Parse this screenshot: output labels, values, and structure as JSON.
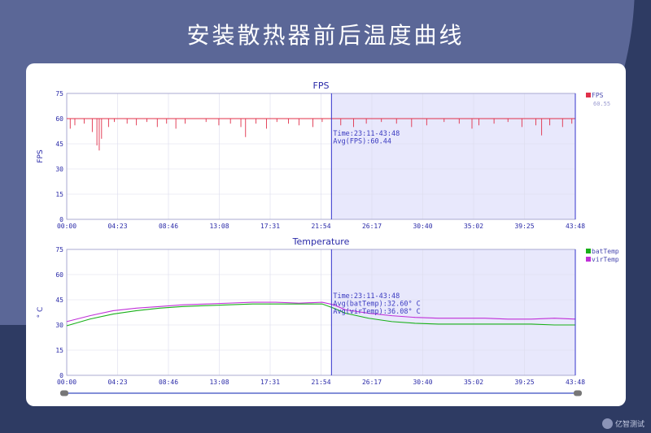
{
  "headline": "安装散热器前后温度曲线",
  "watermark": "亿智测试",
  "colors": {
    "fps": "#e0304a",
    "batTemp": "#18b018",
    "virTemp": "#c030d8",
    "highlight": "#e8e8fc",
    "cursor": "#3333cc",
    "axis_text": "#2a2aa8"
  },
  "chart_data": [
    {
      "type": "line",
      "title": "FPS",
      "ylabel": "FPS",
      "xlabel": "",
      "ylim": [
        0,
        75
      ],
      "yticks": [
        "0",
        "15",
        "30",
        "45",
        "60",
        "75"
      ],
      "xticks": [
        "00:00",
        "04:23",
        "08:46",
        "13:08",
        "17:31",
        "21:54",
        "26:17",
        "30:40",
        "35:02",
        "39:25",
        "43:48"
      ],
      "grid": true,
      "legend": "top-right",
      "highlight_range": [
        22.8,
        43.8
      ],
      "cursor_at": 22.8,
      "annotation": [
        "Time:23:11-43:48",
        "Avg(FPS):60.44"
      ],
      "series": [
        {
          "name": "FPS",
          "legend_sub": "60.55",
          "baseline": 60,
          "dips": [
            [
              0.3,
              54
            ],
            [
              0.7,
              56
            ],
            [
              1.5,
              57
            ],
            [
              2.2,
              52
            ],
            [
              2.6,
              44
            ],
            [
              2.8,
              41
            ],
            [
              3.0,
              48
            ],
            [
              3.6,
              55
            ],
            [
              4.1,
              58
            ],
            [
              5.2,
              57
            ],
            [
              6.0,
              56
            ],
            [
              6.9,
              58
            ],
            [
              7.8,
              55
            ],
            [
              8.6,
              57
            ],
            [
              9.4,
              54
            ],
            [
              10.2,
              57
            ],
            [
              12.0,
              58
            ],
            [
              13.1,
              56
            ],
            [
              14.1,
              57
            ],
            [
              15.0,
              55
            ],
            [
              15.4,
              49
            ],
            [
              16.3,
              57
            ],
            [
              17.2,
              54
            ],
            [
              18.1,
              58
            ],
            [
              19.1,
              57
            ],
            [
              20.0,
              56
            ],
            [
              21.2,
              55
            ],
            [
              22.0,
              58
            ],
            [
              23.6,
              56
            ],
            [
              24.7,
              55
            ],
            [
              25.8,
              57
            ],
            [
              27.1,
              58
            ],
            [
              28.4,
              57
            ],
            [
              29.7,
              55
            ],
            [
              31.0,
              56
            ],
            [
              32.5,
              58
            ],
            [
              33.8,
              57
            ],
            [
              34.9,
              54
            ],
            [
              35.5,
              56
            ],
            [
              36.8,
              57
            ],
            [
              38.0,
              58
            ],
            [
              39.2,
              55
            ],
            [
              40.4,
              56
            ],
            [
              40.9,
              50
            ],
            [
              41.6,
              56
            ],
            [
              42.7,
              55
            ],
            [
              43.5,
              57
            ]
          ]
        }
      ]
    },
    {
      "type": "line",
      "title": "Temperature",
      "ylabel": "° C",
      "xlabel": "",
      "ylim": [
        0,
        75
      ],
      "yticks": [
        "0",
        "15",
        "30",
        "45",
        "60",
        "75"
      ],
      "xticks": [
        "00:00",
        "04:23",
        "08:46",
        "13:08",
        "17:31",
        "21:54",
        "26:17",
        "30:40",
        "35:02",
        "39:25",
        "43:48"
      ],
      "grid": true,
      "legend": "top-right",
      "highlight_range": [
        22.8,
        43.8
      ],
      "cursor_at": 22.8,
      "annotation": [
        "Time:23:11-43:48",
        "Avg(batTemp):32.60° C",
        "Avg(virTemp):36.08° C"
      ],
      "series": [
        {
          "name": "batTemp",
          "x": [
            0,
            2,
            4,
            6,
            8,
            10,
            12,
            14,
            16,
            18,
            20,
            22,
            23,
            24,
            26,
            28,
            30,
            32,
            34,
            36,
            38,
            40,
            42,
            43.8
          ],
          "y": [
            29.5,
            33.5,
            36.5,
            38.5,
            40,
            41,
            41.5,
            42,
            42.5,
            42.5,
            42.5,
            42.5,
            40,
            37,
            34,
            32,
            31,
            30.5,
            30.5,
            30.5,
            30.5,
            30.5,
            30,
            30
          ]
        },
        {
          "name": "virTemp",
          "x": [
            0,
            2,
            4,
            6,
            8,
            10,
            12,
            14,
            16,
            18,
            20,
            22,
            23,
            24,
            26,
            28,
            30,
            32,
            34,
            36,
            38,
            40,
            42,
            43.8
          ],
          "y": [
            32,
            35.5,
            38.5,
            40,
            41,
            42,
            42.5,
            43,
            43.5,
            43.5,
            43,
            43.5,
            42,
            39,
            37,
            35.5,
            34.5,
            34,
            34,
            34,
            33.5,
            33.5,
            34,
            33.5
          ]
        }
      ]
    }
  ],
  "x_range": [
    0,
    43.8
  ]
}
